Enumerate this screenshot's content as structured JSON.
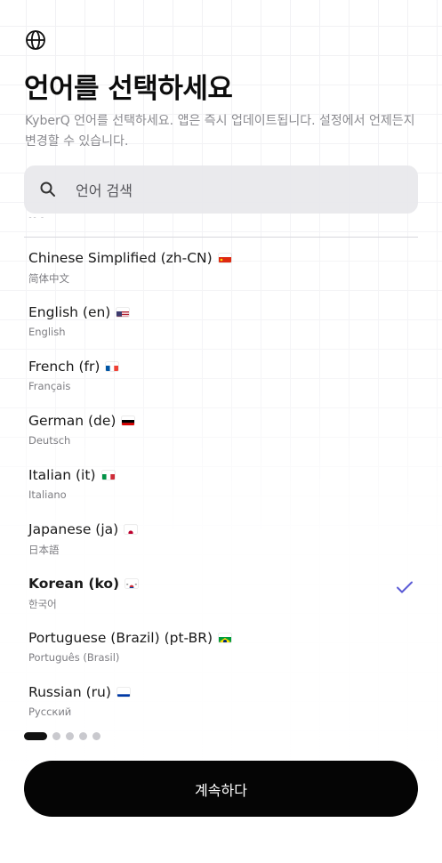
{
  "header": {
    "title": "언어를 선택하세요",
    "subtitle": "KyberQ 언어를 선택하세요. 앱은 즉시 업데이트됩니다. 설정에서 언제든지 변경할 수 있습니다."
  },
  "search": {
    "placeholder": "언어 검색"
  },
  "languages": [
    {
      "name": "Chinese Simplified (zh-CN)",
      "native": "简体中文",
      "flag": "cn",
      "selected": false
    },
    {
      "name": "English (en)",
      "native": "English",
      "flag": "us",
      "selected": false
    },
    {
      "name": "French (fr)",
      "native": "Français",
      "flag": "fr",
      "selected": false
    },
    {
      "name": "German (de)",
      "native": "Deutsch",
      "flag": "de",
      "selected": false
    },
    {
      "name": "Italian (it)",
      "native": "Italiano",
      "flag": "it",
      "selected": false
    },
    {
      "name": "Japanese (ja)",
      "native": "日本語",
      "flag": "jp",
      "selected": false
    },
    {
      "name": "Korean (ko)",
      "native": "한국어",
      "flag": "kr",
      "selected": true
    },
    {
      "name": "Portuguese (Brazil) (pt-BR)",
      "native": "Português (Brasil)",
      "flag": "br",
      "selected": false
    },
    {
      "name": "Russian (ru)",
      "native": "Русский",
      "flag": "ru",
      "selected": false
    }
  ],
  "pagination": {
    "total": 5,
    "current": 1
  },
  "footer": {
    "continue_label": "계속하다"
  },
  "colors": {
    "accent": "#5b5bd6",
    "button": "#050505",
    "muted": "#8a8a8f"
  }
}
